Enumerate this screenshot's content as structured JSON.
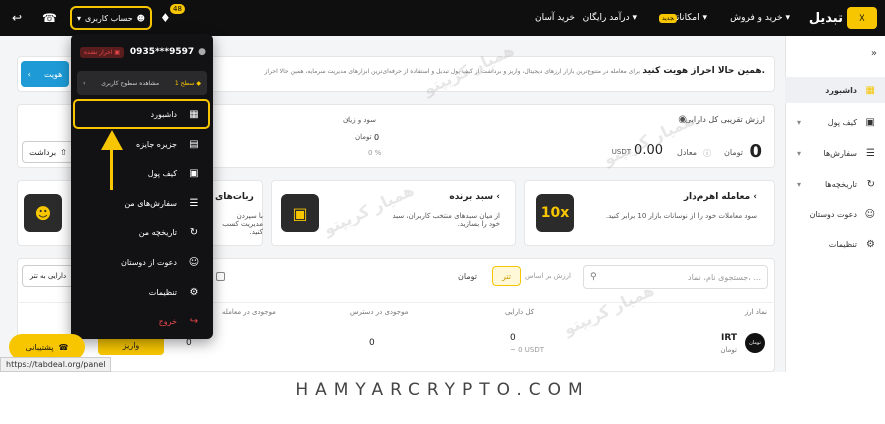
{
  "topbar": {
    "brand": "تبدیل",
    "logo_mark": "tabdeal-logo",
    "nav": [
      "خرید و فروش",
      "امکانات",
      "درآمد رایگان",
      "خرید آسان"
    ],
    "new_badge": "جدید",
    "user_button": "حساب کاربری",
    "notif_count": "48",
    "icons": [
      "bell-icon",
      "headset-icon",
      "logout-icon"
    ]
  },
  "sidebar": {
    "items": [
      {
        "label": "داشبورد",
        "icon": "dashboard-icon"
      },
      {
        "label": "کیف پول",
        "icon": "wallet-icon"
      },
      {
        "label": "سفارش‌ها",
        "icon": "orders-icon"
      },
      {
        "label": "تاریخچه‌ها",
        "icon": "history-icon"
      },
      {
        "label": "دعوت دوستان",
        "icon": "invite-icon"
      },
      {
        "label": "تنظیمات",
        "icon": "settings-icon"
      }
    ]
  },
  "verify_banner": {
    "title": "همین حالا احراز هویت کنید.",
    "desc": "برای معامله در متنوع‌ترین بازار ارزهای دیجیتال، واریز و برداشت از کیف پول تبدیل و استفاده از حرفه‌ای‌ترین ابزارهای مدیریت سرمایه، همین حالا احراز",
    "button": "هویت"
  },
  "balance": {
    "title": "ارزش تقریبی کل دارایی",
    "value": "0",
    "unit": "تومان",
    "equiv": "معادل",
    "usdt_value": "0.00",
    "usdt": "USDT",
    "pnl_title": "سود و زیان",
    "pnl_value": "0",
    "pnl_unit": "تومان",
    "pnl_pct": "0 %",
    "withdraw": "برداشت"
  },
  "promos": [
    {
      "title": "معامله اهرم‌دار",
      "desc": "سود معاملات خود را از نوسانات بازار 10 برابر کنید.",
      "icon": "10x"
    },
    {
      "title": "سبد برنده",
      "desc": "از میان سبدهای منتخب کاربران، سبد خود را بسازید.",
      "icon": "briefcase-icon"
    },
    {
      "title": "ربات‌های",
      "desc": "با سپردن مدیریت کسب کنید.",
      "icon": "robot-icon"
    }
  ],
  "assets": {
    "search_placeholder": "جستجوی نام، نماد، ...",
    "sort_label": "ارزش بر اساس",
    "toggle": [
      "تتر",
      "تومان"
    ],
    "to_tether": "دارایی به تتر",
    "columns": [
      "نماد ارز",
      "کل دارایی",
      "موجودی در دسترس",
      "موجودی در معامله"
    ],
    "row": {
      "symbol": "IRT",
      "name": "تومان",
      "coin_icon": "تومان",
      "total": "0",
      "total_usdt": "~ 0 USDT",
      "available": "0",
      "in_trade": "0",
      "deposit": "واریز"
    }
  },
  "menu": {
    "phone": "0935***9597",
    "verify": "احراز نشده",
    "level": "سطح 1",
    "level_link": "مشاهده سطوح کاربری",
    "items": [
      {
        "label": "داشبورد",
        "icon": "grid-icon"
      },
      {
        "label": "جزیره جایزه",
        "icon": "gift-icon"
      },
      {
        "label": "کیف پول",
        "icon": "wallet-icon"
      },
      {
        "label": "سفارش‌های من",
        "icon": "orders-icon"
      },
      {
        "label": "تاریخچه من",
        "icon": "history-icon"
      },
      {
        "label": "دعوت از دوستان",
        "icon": "invite-icon"
      },
      {
        "label": "تنظیمات",
        "icon": "settings-icon"
      },
      {
        "label": "خروج",
        "icon": "logout-icon"
      }
    ],
    "colors": {
      "accent": "#f7c600",
      "danger": "#e8474b"
    }
  },
  "support": {
    "label": "پشتیبانی"
  },
  "statusbar": {
    "url": "https://tabdeal.org/panel"
  },
  "footer": {
    "watermark": "HAMYARCRYPTO.COM",
    "wm_text": "همیار کریپتو"
  }
}
